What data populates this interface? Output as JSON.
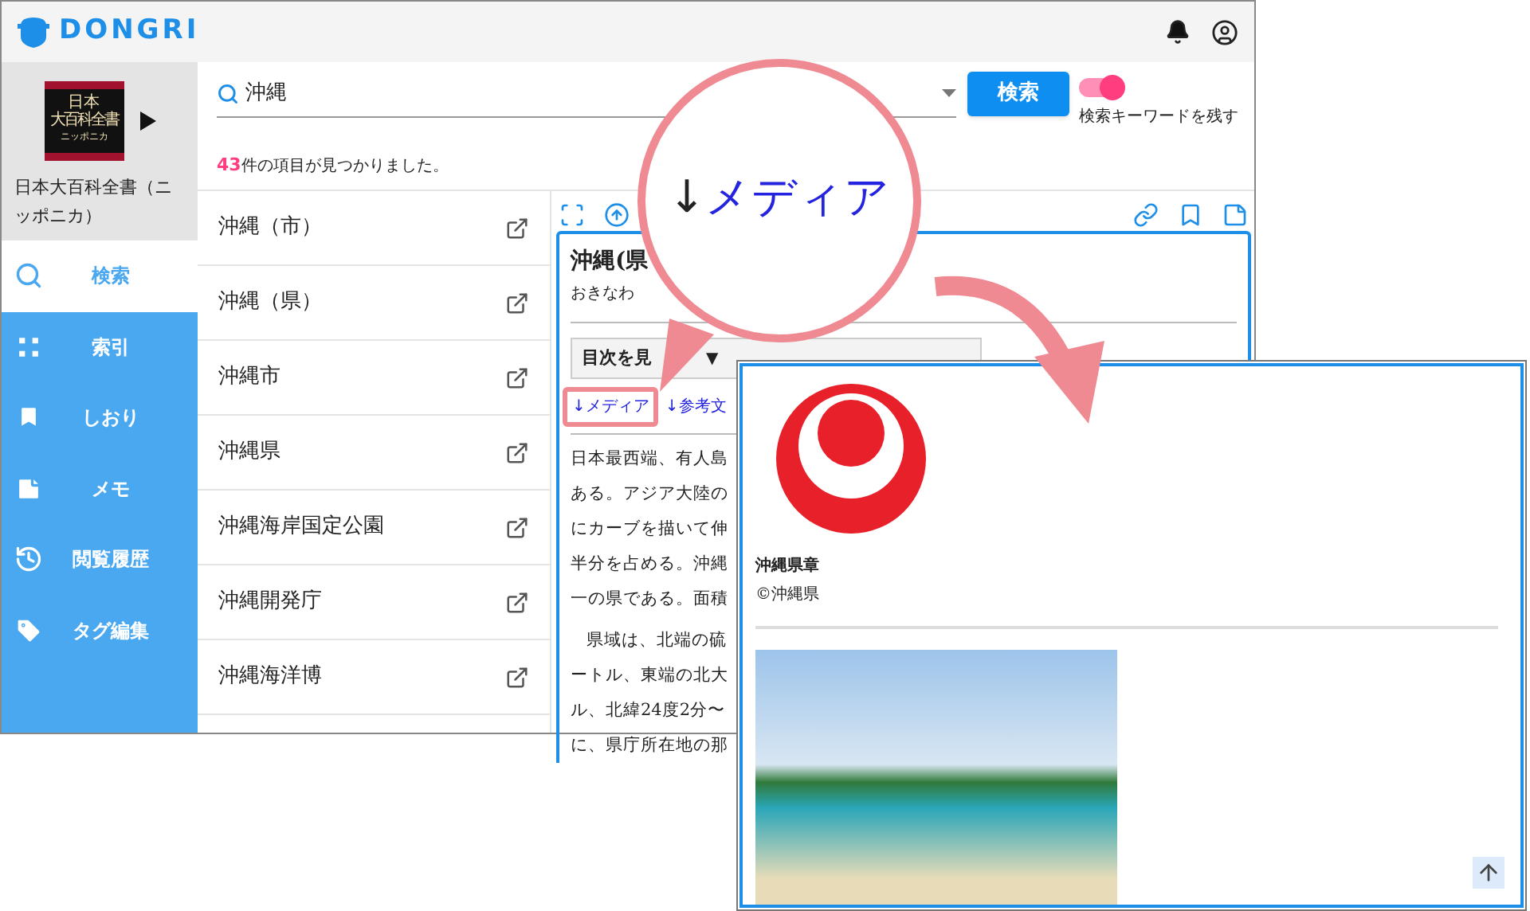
{
  "header": {
    "logo": "DONGRI"
  },
  "book": {
    "cover_lines": [
      "日本",
      "大百科全書",
      "ニッポニカ"
    ],
    "title": "日本大百科全書（ニッポニカ）"
  },
  "nav": [
    {
      "label": "検索",
      "kind": "search",
      "selected": true
    },
    {
      "label": "索引",
      "kind": "index",
      "selected": false
    },
    {
      "label": "しおり",
      "kind": "bookmark",
      "selected": false
    },
    {
      "label": "メモ",
      "kind": "memo",
      "selected": false
    },
    {
      "label": "閲覧履歴",
      "kind": "history",
      "selected": false
    },
    {
      "label": "タグ編集",
      "kind": "tag",
      "selected": false
    }
  ],
  "search": {
    "value": "沖縄",
    "button": "検索",
    "keep_keyword": {
      "label": "検索キーワードを残す",
      "on": true
    }
  },
  "result_count": {
    "count": "43",
    "text": "件の項目が見つかりました。"
  },
  "results": [
    "沖縄（市）",
    "沖縄（県）",
    "沖縄市",
    "沖縄県",
    "沖縄海岸国定公園",
    "沖縄開発庁",
    "沖縄海洋博"
  ],
  "article": {
    "title": "沖縄(県",
    "reading": "おきなわ",
    "toc_button": "目次を見",
    "toc_caret": "▼",
    "links": [
      {
        "label": "↓メディア",
        "highlighted": true
      },
      {
        "label": "↓参考文",
        "highlighted": false
      }
    ],
    "paragraphs": [
      [
        "日本最西端、有人島",
        "ある。アジア大陸の",
        "にカーブを描いて伸",
        "半分を占める。沖縄",
        "一の県である。面積"
      ],
      [
        "県域は、北端の硫",
        "ートル、東端の北大",
        "ル、北緯24度2分〜",
        "に、県庁所在地の那"
      ]
    ]
  },
  "callout": {
    "arrow": "↓",
    "label": "メディア"
  },
  "media_popup": {
    "caption": "沖縄県章",
    "credit": "©沖縄県"
  }
}
